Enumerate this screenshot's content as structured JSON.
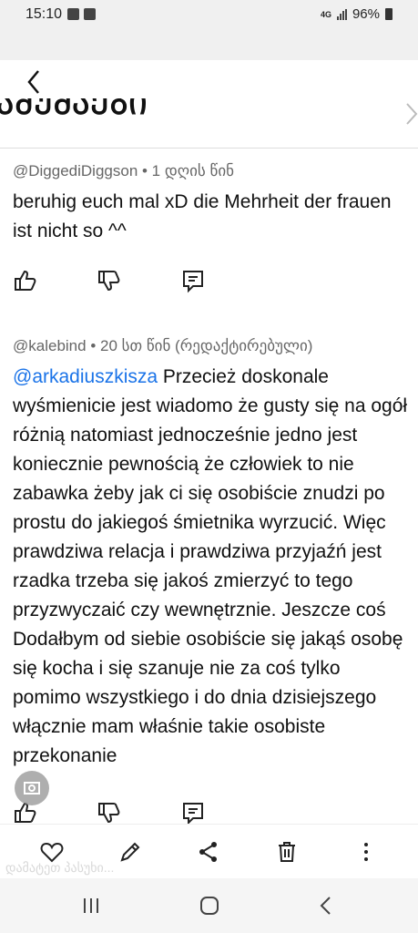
{
  "status": {
    "time": "15:10",
    "network": "4G",
    "battery": "96%"
  },
  "title_fragment": "ᲐᲛᲣᲨᲐᲔᲑᲘ",
  "comments": [
    {
      "author": "@DiggediDiggson",
      "meta": " • 1 დღის წინ",
      "text": "beruhig euch mal xD die Mehrheit der frauen ist nicht so ^^"
    },
    {
      "author": "@kalebind",
      "meta": " • 20 სთ წინ (რედაქტირებული)",
      "mention": "@arkadiuszkisza",
      "text": " Przecież doskonale wyśmienicie jest wiadomo że gusty się na ogół różnią natomiast jednocześnie jedno jest koniecznie pewnością że człowiek to nie zabawka żeby jak ci się osobiście znudzi po prostu do jakiegoś śmietnika wyrzucić. Więc prawdziwa relacja i prawdziwa przyjaźń jest rzadka trzeba się jakoś zmierzyć to tego przyzwyczaić czy wewnętrznie. Jeszcze coś Dodałbym od siebie osobiście się jakąś osobę się kocha i się szanuje nie za coś tylko pomimo wszystkiego i do dnia dzisiejszego włącznie mam właśnie takie osobiste przekonanie"
    }
  ],
  "ghost_text": "დამატეთ პასუხი...",
  "icons": {
    "back": "chevron-left-icon",
    "like": "thumbs-up-icon",
    "dislike": "thumbs-down-icon",
    "reply": "reply-icon",
    "favorite": "heart-icon",
    "edit": "pencil-icon",
    "share": "share-icon",
    "delete": "trash-icon",
    "more": "more-vertical-icon",
    "recents": "recents-icon",
    "home": "home-icon",
    "nav_back": "back-icon"
  }
}
